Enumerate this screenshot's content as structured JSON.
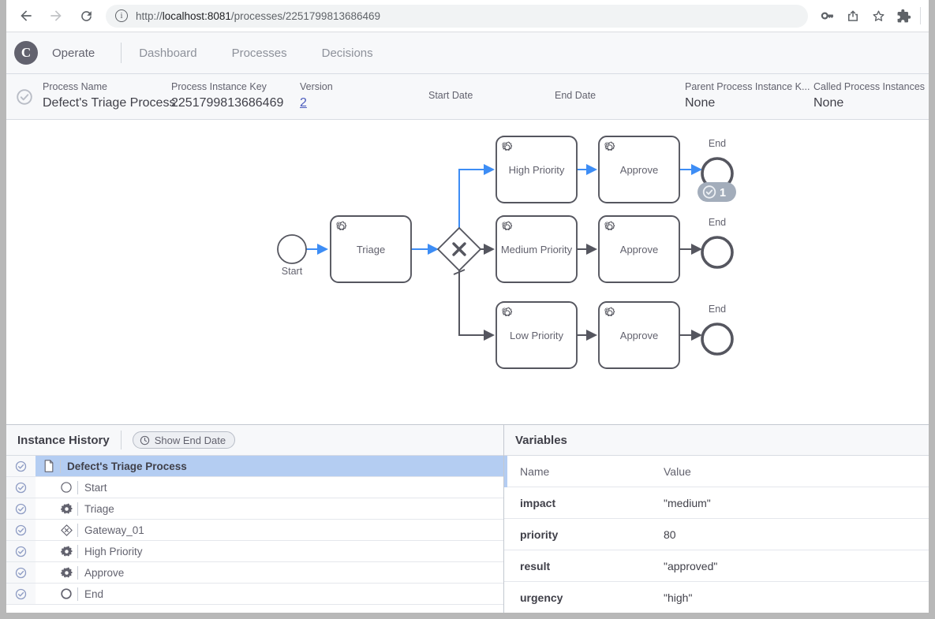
{
  "browser": {
    "back_icon": "arrow-left-icon",
    "forward_icon": "arrow-right-icon",
    "reload_icon": "reload-icon",
    "site_info_icon": "info-circle-icon",
    "url_scheme": "http://",
    "url_host": "localhost:8081",
    "url_path": "/processes/2251799813686469",
    "url_full": "http://localhost:8081/processes/2251799813686469",
    "actions": [
      {
        "name": "password-key-icon",
        "glyph": "key"
      },
      {
        "name": "share-icon",
        "glyph": "share"
      },
      {
        "name": "bookmark-star-icon",
        "glyph": "star"
      },
      {
        "name": "extensions-puzzle-icon",
        "glyph": "puzzle"
      }
    ]
  },
  "app": {
    "logo_letter": "C",
    "brand": "Operate",
    "nav": [
      {
        "label": "Dashboard"
      },
      {
        "label": "Processes"
      },
      {
        "label": "Decisions"
      }
    ]
  },
  "instance_header": {
    "state_icon": "check-circle-icon",
    "fields": [
      {
        "label": "Process Name",
        "value": "Defect's Triage Process",
        "link": false
      },
      {
        "label": "Process Instance Key",
        "value": "2251799813686469",
        "link": false
      },
      {
        "label": "Version",
        "value": "2",
        "link": true
      },
      {
        "label": "Start Date",
        "value": "",
        "link": false
      },
      {
        "label": "End Date",
        "value": "",
        "link": false
      },
      {
        "label": "Parent Process Instance K...",
        "value": "None",
        "link": false
      },
      {
        "label": "Called Process Instances",
        "value": "None",
        "link": false
      }
    ]
  },
  "diagram": {
    "type": "bpmn",
    "colors": {
      "stroke": "#55565f",
      "active": "#3d8df5",
      "label": "#62626e",
      "badge_bg": "#a3adbb"
    },
    "nodes": [
      {
        "id": "start",
        "name": "Start",
        "type": "start-event",
        "label_position": "below"
      },
      {
        "id": "triage",
        "name": "Triage",
        "type": "service-task"
      },
      {
        "id": "gateway",
        "name": "Gateway_01",
        "type": "exclusive-gateway",
        "marker": "X"
      },
      {
        "id": "high",
        "name": "High Priority",
        "type": "service-task"
      },
      {
        "id": "approve_high",
        "name": "Approve",
        "type": "service-task"
      },
      {
        "id": "end_high",
        "name": "End",
        "type": "end-event",
        "label_position": "above",
        "badge_count": "1",
        "badge_icon": "check-circle-icon"
      },
      {
        "id": "medium",
        "name": "Medium Priority",
        "type": "service-task"
      },
      {
        "id": "approve_medium",
        "name": "Approve",
        "type": "service-task"
      },
      {
        "id": "end_medium",
        "name": "End",
        "type": "end-event",
        "label_position": "above"
      },
      {
        "id": "low",
        "name": "Low Priority",
        "type": "service-task"
      },
      {
        "id": "approve_low",
        "name": "Approve",
        "type": "service-task"
      },
      {
        "id": "end_low",
        "name": "End",
        "type": "end-event",
        "label_position": "above"
      }
    ],
    "active_path": [
      "start",
      "triage",
      "gateway",
      "high",
      "approve_high",
      "end_high"
    ]
  },
  "instance_history": {
    "title": "Instance History",
    "toggle": {
      "label": "Show End Date",
      "icon": "clock-icon"
    },
    "rows": [
      {
        "label": "Defect's Triage Process",
        "icon": "process-document-icon",
        "state_icon": "check-circle-icon",
        "selected": true,
        "indent": false
      },
      {
        "label": "Start",
        "icon": "start-event-icon",
        "state_icon": "check-circle-icon",
        "selected": false,
        "indent": true
      },
      {
        "label": "Triage",
        "icon": "service-task-icon",
        "state_icon": "check-circle-icon",
        "selected": false,
        "indent": true
      },
      {
        "label": "Gateway_01",
        "icon": "exclusive-gateway-icon",
        "state_icon": "check-circle-icon",
        "selected": false,
        "indent": true
      },
      {
        "label": "High Priority",
        "icon": "service-task-icon",
        "state_icon": "check-circle-icon",
        "selected": false,
        "indent": true
      },
      {
        "label": "Approve",
        "icon": "service-task-icon",
        "state_icon": "check-circle-icon",
        "selected": false,
        "indent": true
      },
      {
        "label": "End",
        "icon": "end-event-icon",
        "state_icon": "check-circle-icon",
        "selected": false,
        "indent": true
      }
    ]
  },
  "variables": {
    "title": "Variables",
    "columns": {
      "name": "Name",
      "value": "Value"
    },
    "rows": [
      {
        "name": "impact",
        "value": "\"medium\""
      },
      {
        "name": "priority",
        "value": "80"
      },
      {
        "name": "result",
        "value": "\"approved\""
      },
      {
        "name": "urgency",
        "value": "\"high\""
      }
    ]
  }
}
